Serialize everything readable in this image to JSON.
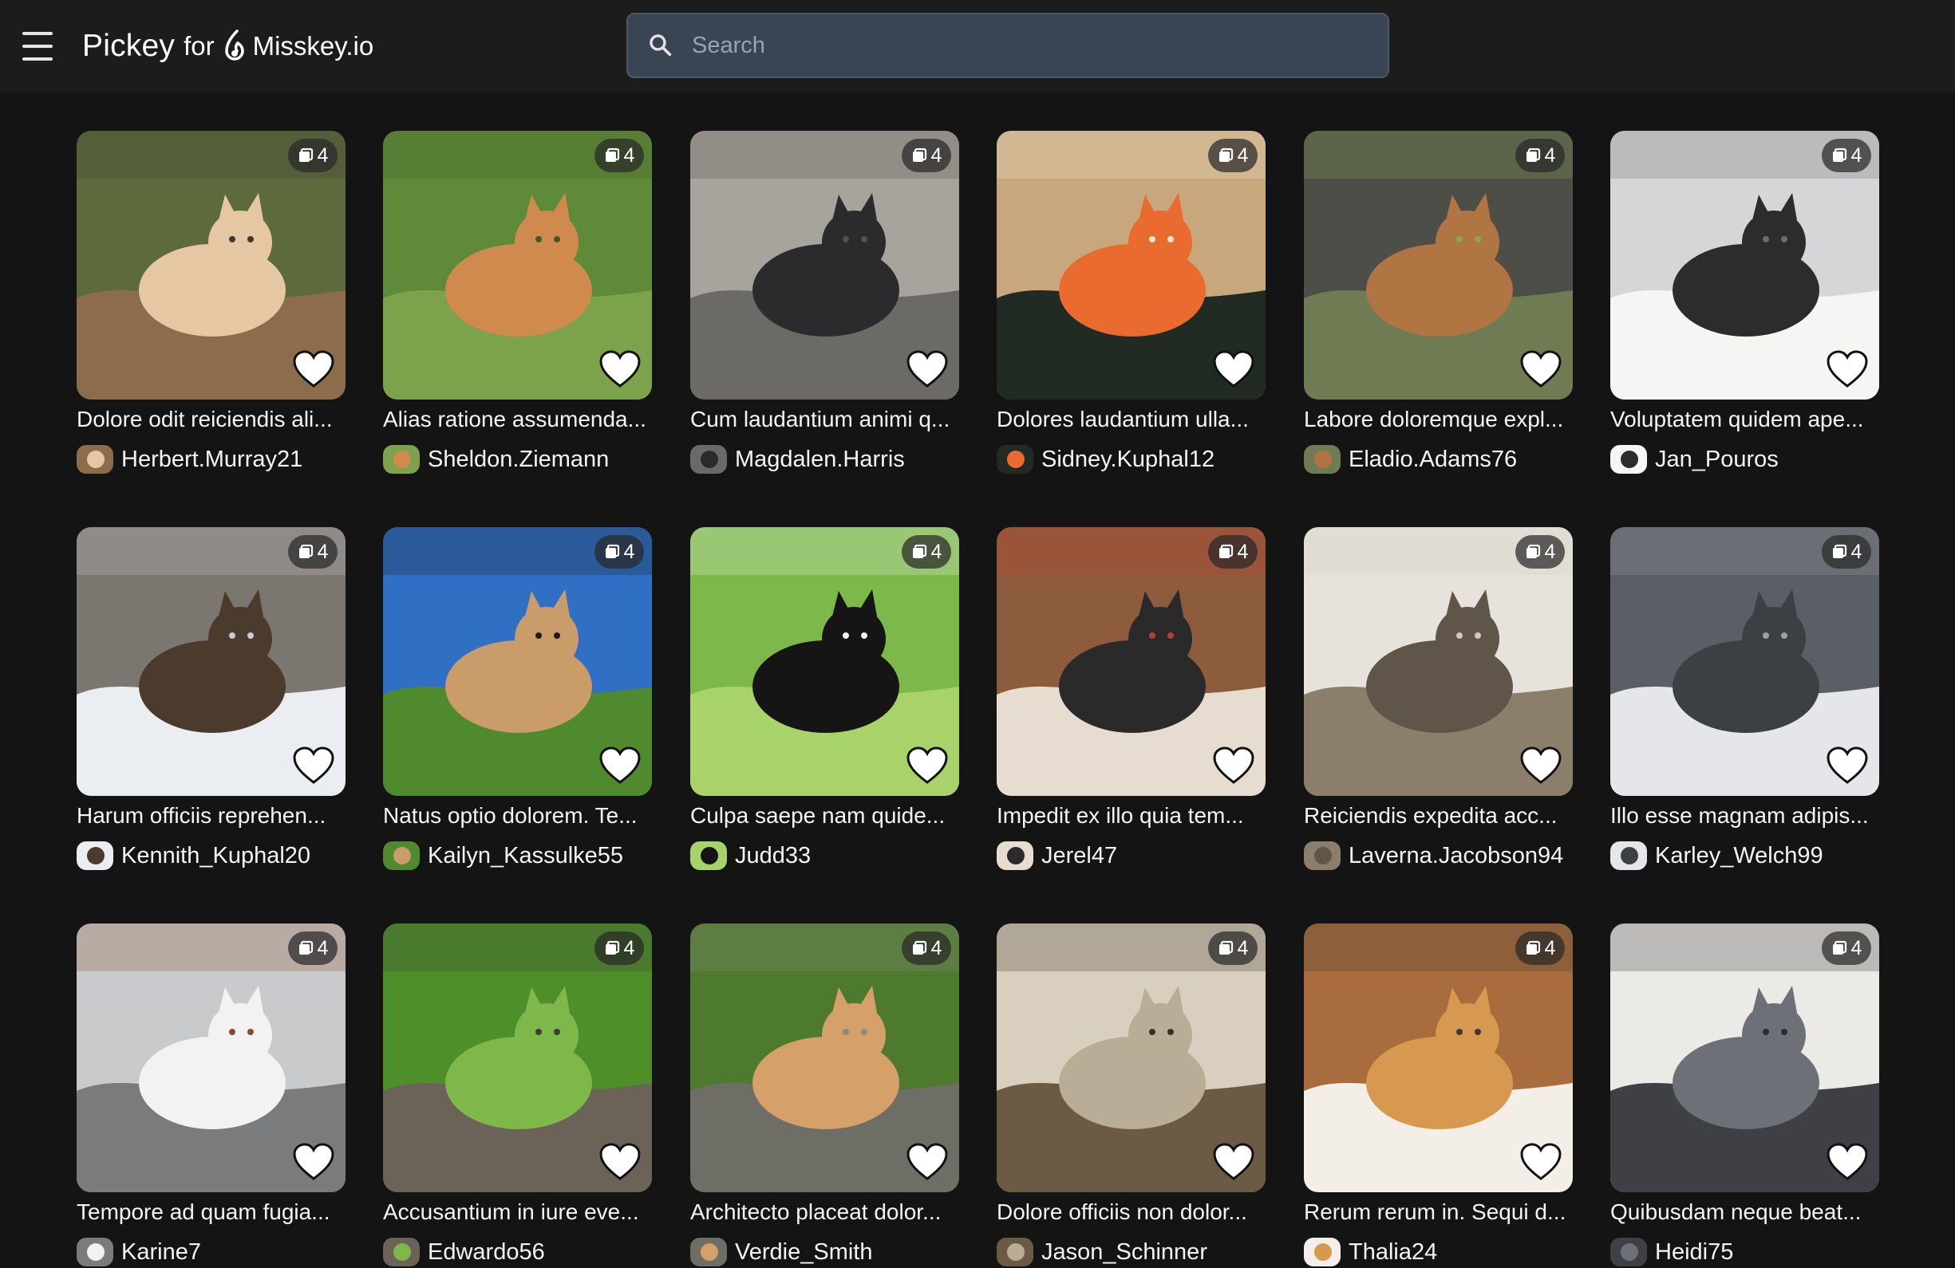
{
  "app": {
    "brand_main": "Pickey",
    "brand_for": "for",
    "brand_instance": "Misskey.io",
    "search_placeholder": "Search"
  },
  "icons": {
    "menu": "menu-icon",
    "logo": "misskey-logo-icon",
    "search": "search-icon",
    "count": "image-stack-icon",
    "favorite": "heart-outline-icon"
  },
  "posts": [
    {
      "title": "Dolore odit reiciendis ali...",
      "author": "Herbert.Murray21",
      "count": "4",
      "colors": [
        "#5d6a3c",
        "#8c6c4a",
        "#e6c7a3",
        "#3c3a2e"
      ]
    },
    {
      "title": "Alias ratione assumenda...",
      "author": "Sheldon.Ziemann",
      "count": "4",
      "colors": [
        "#5f8a3a",
        "#7da24c",
        "#d08a4e",
        "#3d5a28"
      ]
    },
    {
      "title": "Cum laudantium animi q...",
      "author": "Magdalen.Harris",
      "count": "4",
      "colors": [
        "#a7a39d",
        "#6c6a66",
        "#2b2b2d",
        "#545048"
      ]
    },
    {
      "title": "Dolores laudantium ulla...",
      "author": "Sidney.Kuphal12",
      "count": "4",
      "colors": [
        "#c9a77d",
        "#222a24",
        "#e96b2f",
        "#efe8d6"
      ]
    },
    {
      "title": "Labore doloremque expl...",
      "author": "Eladio.Adams76",
      "count": "4",
      "colors": [
        "#4e4e48",
        "#6f7c53",
        "#b07543",
        "#88a84c"
      ]
    },
    {
      "title": "Voluptatem quidem ape...",
      "author": "Jan_Pouros",
      "count": "4",
      "colors": [
        "#d6d6d8",
        "#f5f5f3",
        "#2c2c2c",
        "#6d6d6f"
      ]
    },
    {
      "title": "Harum officiis reprehen...",
      "author": "Kennith_Kuphal20",
      "count": "4",
      "colors": [
        "#7b766f",
        "#eaeef3",
        "#4b3b2c",
        "#c8cdd2"
      ]
    },
    {
      "title": "Natus optio dolorem. Te...",
      "author": "Kailyn_Kassulke55",
      "count": "4",
      "colors": [
        "#2f6fc4",
        "#4f8a2e",
        "#c99c6a",
        "#1c1c1c"
      ]
    },
    {
      "title": "Culpa saepe nam quide...",
      "author": "Judd33",
      "count": "4",
      "colors": [
        "#7cb84a",
        "#a8d36a",
        "#151515",
        "#f3f3f0"
      ]
    },
    {
      "title": "Impedit ex illo quia tem...",
      "author": "Jerel47",
      "count": "4",
      "colors": [
        "#8d5c3c",
        "#e6dcd0",
        "#2a2a2a",
        "#c23b32"
      ]
    },
    {
      "title": "Reiciendis expedita acc...",
      "author": "Laverna.Jacobson94",
      "count": "4",
      "colors": [
        "#e7e3dc",
        "#8b7f6b",
        "#5f5549",
        "#cfc8bb"
      ]
    },
    {
      "title": "Illo esse magnam adipis...",
      "author": "Karley_Welch99",
      "count": "4",
      "colors": [
        "#5a5f66",
        "#e4e6ea",
        "#3c3f44",
        "#9aa0a8"
      ]
    },
    {
      "title": "Tempore ad quam fugia...",
      "author": "Karine7",
      "count": "4",
      "colors": [
        "#c9cacb",
        "#7a7b7c",
        "#f2f2f2",
        "#8b4a2e"
      ]
    },
    {
      "title": "Accusantium in iure eve...",
      "author": "Edwardo56",
      "count": "4",
      "colors": [
        "#4f8f2a",
        "#6b6258",
        "#7fb84a",
        "#3c3c3c"
      ]
    },
    {
      "title": "Architecto placeat dolor...",
      "author": "Verdie_Smith",
      "count": "4",
      "colors": [
        "#4e7a2e",
        "#6e6e66",
        "#d6a06a",
        "#8c8a80"
      ]
    },
    {
      "title": "Dolore officiis non dolor...",
      "author": "Jason_Schinner",
      "count": "4",
      "colors": [
        "#d9cfbf",
        "#6b5a44",
        "#b9ad98",
        "#3a2f24"
      ]
    },
    {
      "title": "Rerum rerum in. Sequi d...",
      "author": "Thalia24",
      "count": "4",
      "colors": [
        "#a96d3d",
        "#f3eee7",
        "#d6994f",
        "#3d3a36"
      ]
    },
    {
      "title": "Quibusdam neque beat...",
      "author": "Heidi75",
      "count": "4",
      "colors": [
        "#eceae6",
        "#3e4045",
        "#6d7076",
        "#2c2d30"
      ]
    }
  ]
}
